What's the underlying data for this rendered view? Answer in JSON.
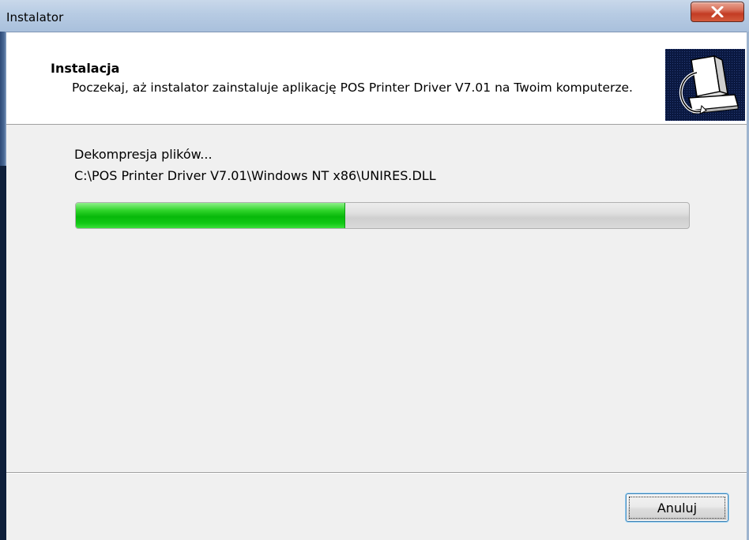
{
  "window": {
    "title": "Instalator"
  },
  "titlebar": {
    "close_icon": "close-icon"
  },
  "header": {
    "title": "Instalacja",
    "description": "Poczekaj, aż instalator zainstaluje aplikację POS Printer Driver V7.01 na Twoim komputerze.",
    "icon": "computer-install-icon"
  },
  "content": {
    "status": "Dekompresja plików...",
    "file_path": "C:\\POS Printer Driver V7.01\\Windows NT x86\\UNIRES.DLL",
    "progress_percent": 44
  },
  "footer": {
    "cancel_label": "Anuluj"
  },
  "colors": {
    "progress_fill": "#07b80a",
    "close_button": "#c33c24",
    "header_background": "#ffffff",
    "dialog_background": "#f0f0f0"
  }
}
